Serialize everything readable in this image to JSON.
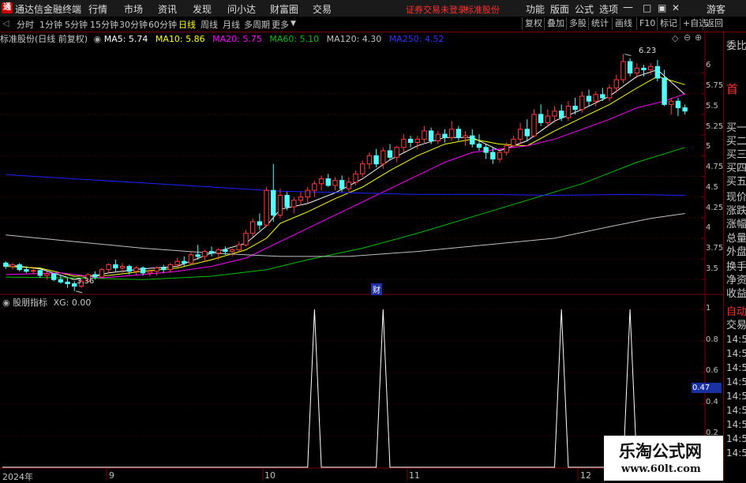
{
  "menubar": {
    "app_title": "通达信金融终端",
    "items": [
      "行情",
      "市场",
      "资讯",
      "发现",
      "问小达",
      "财富圈",
      "交易"
    ],
    "warning": "证券交易未登录",
    "warning2": "标准股份",
    "right_items": [
      "功能",
      "版面",
      "公式",
      "选项"
    ],
    "guest": "游客"
  },
  "toolbar": {
    "periods": [
      "分时",
      "1分钟",
      "5分钟",
      "15分钟",
      "30分钟",
      "60分钟",
      "日线",
      "周线",
      "月线",
      "多周期",
      "更多"
    ],
    "active_period": "日线",
    "right_buttons": [
      "复权",
      "叠加",
      "多股",
      "统计",
      "画线",
      "F10",
      "标记",
      "+自选",
      "返回"
    ]
  },
  "info": {
    "stock": "标准股份(日线 前复权)",
    "ma5": "MA5: 5.74",
    "ma10": "MA10: 5.86",
    "ma20": "MA20: 5.75",
    "ma60": "MA60: 5.10",
    "ma120": "MA120: 4.30",
    "ma250": "MA250: 4.52"
  },
  "sub_info": {
    "indicator": "股朋指标",
    "value": "XG: 0.00"
  },
  "right_panel": {
    "top": "委比",
    "head": "首",
    "labels": [
      "买一",
      "买二",
      "买三",
      "买四",
      "买五",
      "现价",
      "涨跌",
      "涨幅",
      "总量",
      "外盘",
      "换手",
      "净资",
      "收益",
      "自动",
      "交易"
    ],
    "times": [
      "14:5",
      "14:5",
      "14:5",
      "14:5",
      "14:5",
      "14:5",
      "14:5",
      "14:5",
      "14:5"
    ]
  },
  "annotations": {
    "high": "6.23",
    "low": "3.36",
    "cai": "财",
    "cursor_value": "0.47"
  },
  "colors": {
    "up": "#ff3c3c",
    "down": "#54ffff",
    "ma5": "#ffffff",
    "ma10": "#ffff00",
    "ma20": "#ff00ff",
    "ma60": "#00c000",
    "ma120": "#c0c0c0",
    "ma250": "#2020ff",
    "grid": "#7a0000"
  },
  "watermark": {
    "title": "乐淘公式网",
    "url": "www.60lt.com"
  },
  "chart_data": [
    {
      "type": "candlestick",
      "title": "标准股份(日线 前复权)",
      "yticks": [
        6.0,
        5.75,
        5.5,
        5.25,
        5.0,
        4.75,
        4.5,
        4.25,
        4.0,
        3.75,
        3.5
      ],
      "ylim": [
        3.33,
        6.35
      ],
      "xticks": [
        "2024年",
        "9",
        "10",
        "11",
        "12"
      ],
      "bars": [
        [
          3.7,
          3.72,
          3.63,
          3.66
        ],
        [
          3.66,
          3.7,
          3.62,
          3.68
        ],
        [
          3.68,
          3.7,
          3.6,
          3.62
        ],
        [
          3.62,
          3.66,
          3.58,
          3.6
        ],
        [
          3.6,
          3.64,
          3.56,
          3.61
        ],
        [
          3.61,
          3.62,
          3.52,
          3.55
        ],
        [
          3.55,
          3.6,
          3.5,
          3.57
        ],
        [
          3.57,
          3.58,
          3.48,
          3.5
        ],
        [
          3.5,
          3.55,
          3.45,
          3.47
        ],
        [
          3.47,
          3.52,
          3.4,
          3.45
        ],
        [
          3.45,
          3.48,
          3.36,
          3.42
        ],
        [
          3.42,
          3.5,
          3.4,
          3.48
        ],
        [
          3.48,
          3.58,
          3.46,
          3.56
        ],
        [
          3.56,
          3.6,
          3.5,
          3.53
        ],
        [
          3.53,
          3.64,
          3.52,
          3.62
        ],
        [
          3.62,
          3.7,
          3.58,
          3.68
        ],
        [
          3.68,
          3.74,
          3.6,
          3.64
        ],
        [
          3.64,
          3.7,
          3.58,
          3.66
        ],
        [
          3.66,
          3.68,
          3.56,
          3.6
        ],
        [
          3.6,
          3.66,
          3.56,
          3.64
        ],
        [
          3.64,
          3.66,
          3.55,
          3.58
        ],
        [
          3.58,
          3.62,
          3.54,
          3.6
        ],
        [
          3.6,
          3.66,
          3.55,
          3.64
        ],
        [
          3.64,
          3.68,
          3.58,
          3.62
        ],
        [
          3.62,
          3.7,
          3.58,
          3.68
        ],
        [
          3.68,
          3.76,
          3.64,
          3.72
        ],
        [
          3.72,
          3.78,
          3.66,
          3.7
        ],
        [
          3.7,
          3.84,
          3.68,
          3.8
        ],
        [
          3.8,
          3.92,
          3.74,
          3.78
        ],
        [
          3.78,
          3.86,
          3.72,
          3.84
        ],
        [
          3.84,
          3.9,
          3.78,
          3.82
        ],
        [
          3.82,
          3.88,
          3.74,
          3.86
        ],
        [
          3.86,
          3.9,
          3.8,
          3.84
        ],
        [
          3.84,
          3.88,
          3.78,
          3.86
        ],
        [
          3.86,
          3.96,
          3.84,
          3.92
        ],
        [
          3.92,
          4.1,
          3.9,
          4.06
        ],
        [
          4.06,
          4.24,
          4.02,
          4.2
        ],
        [
          4.2,
          4.3,
          4.1,
          4.16
        ],
        [
          4.16,
          4.62,
          4.14,
          4.58
        ],
        [
          4.58,
          4.9,
          4.2,
          4.28
        ],
        [
          4.28,
          4.6,
          4.24,
          4.52
        ],
        [
          4.52,
          4.56,
          4.34,
          4.38
        ],
        [
          4.38,
          4.5,
          4.3,
          4.46
        ],
        [
          4.46,
          4.56,
          4.4,
          4.5
        ],
        [
          4.5,
          4.62,
          4.42,
          4.58
        ],
        [
          4.58,
          4.7,
          4.5,
          4.66
        ],
        [
          4.66,
          4.76,
          4.58,
          4.72
        ],
        [
          4.72,
          4.78,
          4.62,
          4.64
        ],
        [
          4.64,
          4.74,
          4.58,
          4.7
        ],
        [
          4.7,
          4.76,
          4.56,
          4.6
        ],
        [
          4.6,
          4.74,
          4.56,
          4.68
        ],
        [
          4.68,
          4.82,
          4.64,
          4.78
        ],
        [
          4.78,
          4.94,
          4.74,
          4.9
        ],
        [
          4.9,
          5.04,
          4.84,
          5.0
        ],
        [
          5.0,
          5.08,
          4.86,
          4.9
        ],
        [
          4.9,
          5.1,
          4.84,
          5.06
        ],
        [
          5.06,
          5.14,
          4.94,
          4.98
        ],
        [
          4.98,
          5.12,
          4.92,
          5.1
        ],
        [
          5.1,
          5.26,
          5.04,
          5.2
        ],
        [
          5.2,
          5.24,
          5.1,
          5.16
        ],
        [
          5.16,
          5.24,
          5.08,
          5.2
        ],
        [
          5.2,
          5.36,
          5.14,
          5.3
        ],
        [
          5.3,
          5.34,
          5.14,
          5.18
        ],
        [
          5.18,
          5.3,
          5.14,
          5.26
        ],
        [
          5.26,
          5.32,
          5.16,
          5.22
        ],
        [
          5.22,
          5.42,
          5.18,
          5.32
        ],
        [
          5.32,
          5.36,
          5.18,
          5.22
        ],
        [
          5.22,
          5.3,
          5.12,
          5.24
        ],
        [
          5.24,
          5.32,
          5.1,
          5.14
        ],
        [
          5.14,
          5.26,
          5.06,
          5.1
        ],
        [
          5.1,
          5.14,
          4.96,
          5.04
        ],
        [
          5.04,
          5.1,
          4.9,
          4.96
        ],
        [
          4.96,
          5.06,
          4.92,
          5.04
        ],
        [
          5.04,
          5.16,
          5.0,
          5.12
        ],
        [
          5.12,
          5.24,
          5.1,
          5.2
        ],
        [
          5.2,
          5.4,
          5.14,
          5.32
        ],
        [
          5.32,
          5.44,
          5.18,
          5.24
        ],
        [
          5.24,
          5.56,
          5.22,
          5.5
        ],
        [
          5.5,
          5.62,
          5.36,
          5.4
        ],
        [
          5.4,
          5.56,
          5.34,
          5.48
        ],
        [
          5.48,
          5.6,
          5.4,
          5.54
        ],
        [
          5.54,
          5.62,
          5.42,
          5.46
        ],
        [
          5.46,
          5.66,
          5.42,
          5.6
        ],
        [
          5.6,
          5.7,
          5.5,
          5.56
        ],
        [
          5.56,
          5.78,
          5.52,
          5.72
        ],
        [
          5.72,
          5.8,
          5.6,
          5.66
        ],
        [
          5.66,
          5.78,
          5.6,
          5.74
        ],
        [
          5.74,
          5.82,
          5.66,
          5.7
        ],
        [
          5.7,
          5.86,
          5.66,
          5.82
        ],
        [
          5.82,
          5.98,
          5.76,
          5.92
        ],
        [
          5.92,
          6.23,
          5.88,
          6.14
        ],
        [
          6.14,
          6.18,
          5.96,
          6.0
        ],
        [
          6.0,
          6.12,
          5.94,
          6.06
        ],
        [
          6.06,
          6.1,
          5.96,
          6.04
        ],
        [
          6.04,
          6.12,
          5.98,
          6.08
        ],
        [
          6.08,
          6.16,
          5.9,
          5.94
        ],
        [
          5.94,
          6.04,
          5.6,
          5.62
        ],
        [
          5.62,
          5.7,
          5.5,
          5.66
        ],
        [
          5.66,
          5.7,
          5.48,
          5.58
        ],
        [
          5.58,
          5.62,
          5.5,
          5.54
        ]
      ],
      "ma_series": [
        {
          "name": "MA5",
          "points": [
            [
              0,
              3.68
            ],
            [
              5,
              3.63
            ],
            [
              10,
              3.5
            ],
            [
              15,
              3.58
            ],
            [
              20,
              3.63
            ],
            [
              25,
              3.66
            ],
            [
              30,
              3.82
            ],
            [
              35,
              3.94
            ],
            [
              38,
              4.15
            ],
            [
              40,
              4.35
            ],
            [
              44,
              4.42
            ],
            [
              48,
              4.55
            ],
            [
              52,
              4.72
            ],
            [
              56,
              4.95
            ],
            [
              60,
              5.12
            ],
            [
              64,
              5.22
            ],
            [
              68,
              5.22
            ],
            [
              72,
              5.06
            ],
            [
              76,
              5.18
            ],
            [
              80,
              5.42
            ],
            [
              84,
              5.56
            ],
            [
              88,
              5.72
            ],
            [
              92,
              5.96
            ],
            [
              95,
              6.04
            ],
            [
              99,
              5.74
            ]
          ]
        },
        {
          "name": "MA10",
          "points": [
            [
              0,
              3.66
            ],
            [
              5,
              3.64
            ],
            [
              10,
              3.54
            ],
            [
              15,
              3.55
            ],
            [
              20,
              3.6
            ],
            [
              25,
              3.64
            ],
            [
              30,
              3.74
            ],
            [
              35,
              3.86
            ],
            [
              38,
              4.0
            ],
            [
              40,
              4.18
            ],
            [
              44,
              4.32
            ],
            [
              48,
              4.48
            ],
            [
              52,
              4.62
            ],
            [
              56,
              4.82
            ],
            [
              60,
              5.0
            ],
            [
              64,
              5.14
            ],
            [
              68,
              5.2
            ],
            [
              72,
              5.14
            ],
            [
              76,
              5.12
            ],
            [
              80,
              5.3
            ],
            [
              84,
              5.46
            ],
            [
              88,
              5.62
            ],
            [
              92,
              5.82
            ],
            [
              95,
              5.96
            ],
            [
              99,
              5.86
            ]
          ]
        },
        {
          "name": "MA20",
          "points": [
            [
              0,
              3.56
            ],
            [
              8,
              3.58
            ],
            [
              14,
              3.52
            ],
            [
              20,
              3.56
            ],
            [
              25,
              3.6
            ],
            [
              30,
              3.66
            ],
            [
              35,
              3.76
            ],
            [
              40,
              3.96
            ],
            [
              44,
              4.12
            ],
            [
              48,
              4.28
            ],
            [
              52,
              4.44
            ],
            [
              56,
              4.6
            ],
            [
              60,
              4.76
            ],
            [
              64,
              4.92
            ],
            [
              68,
              5.04
            ],
            [
              72,
              5.08
            ],
            [
              76,
              5.12
            ],
            [
              80,
              5.2
            ],
            [
              84,
              5.32
            ],
            [
              88,
              5.44
            ],
            [
              92,
              5.58
            ],
            [
              96,
              5.66
            ],
            [
              99,
              5.75
            ]
          ]
        },
        {
          "name": "MA60",
          "points": [
            [
              0,
              3.53
            ],
            [
              10,
              3.52
            ],
            [
              20,
              3.5
            ],
            [
              30,
              3.54
            ],
            [
              38,
              3.62
            ],
            [
              44,
              3.74
            ],
            [
              52,
              3.88
            ],
            [
              60,
              4.06
            ],
            [
              68,
              4.26
            ],
            [
              76,
              4.46
            ],
            [
              84,
              4.66
            ],
            [
              92,
              4.92
            ],
            [
              99,
              5.1
            ]
          ]
        },
        {
          "name": "MA120",
          "points": [
            [
              0,
              4.04
            ],
            [
              10,
              3.96
            ],
            [
              20,
              3.88
            ],
            [
              30,
              3.82
            ],
            [
              40,
              3.78
            ],
            [
              50,
              3.78
            ],
            [
              60,
              3.84
            ],
            [
              70,
              3.92
            ],
            [
              80,
              4.0
            ],
            [
              88,
              4.14
            ],
            [
              94,
              4.24
            ],
            [
              99,
              4.3
            ]
          ]
        },
        {
          "name": "MA250",
          "points": [
            [
              0,
              4.77
            ],
            [
              10,
              4.72
            ],
            [
              20,
              4.67
            ],
            [
              30,
              4.62
            ],
            [
              40,
              4.57
            ],
            [
              50,
              4.55
            ],
            [
              60,
              4.53
            ],
            [
              70,
              4.53
            ],
            [
              80,
              4.52
            ],
            [
              90,
              4.53
            ],
            [
              99,
              4.52
            ]
          ]
        }
      ]
    },
    {
      "type": "line",
      "title": "股朋指标",
      "series": [
        {
          "name": "XG",
          "spikes": [
            45,
            55,
            81,
            91
          ]
        }
      ],
      "yticks": [
        1.0,
        0.8,
        0.6,
        0.4,
        0.2
      ],
      "ylim": [
        0,
        1
      ]
    }
  ]
}
